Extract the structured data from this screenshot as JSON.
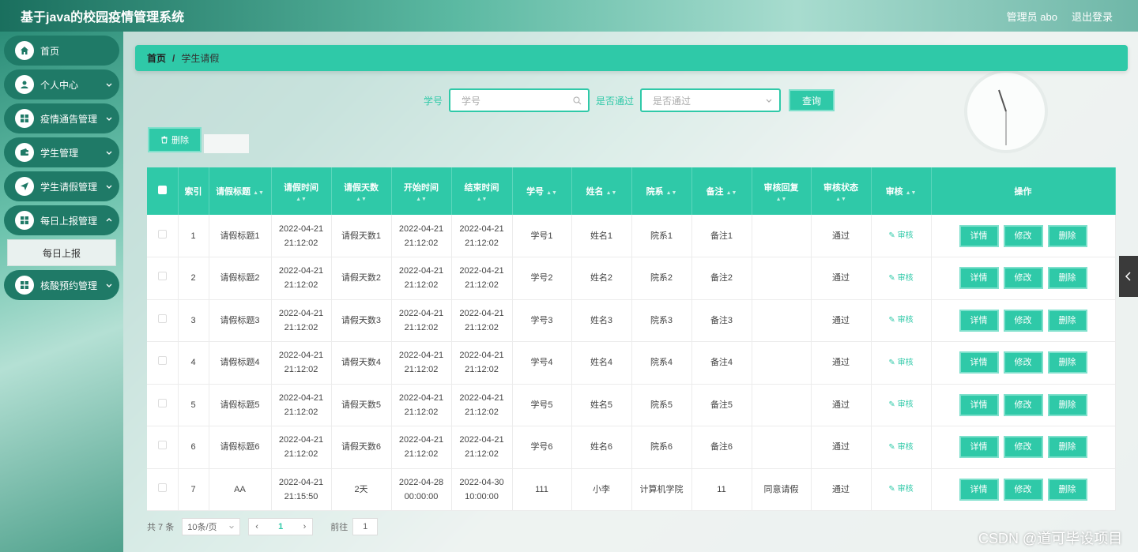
{
  "app": {
    "title": "基于java的校园疫情管理系统",
    "user": "管理员 abo",
    "logout": "退出登录"
  },
  "sidebar": {
    "items": [
      {
        "label": "首页",
        "icon": "home-icon"
      },
      {
        "label": "个人中心",
        "icon": "user-icon"
      },
      {
        "label": "疫情通告管理",
        "icon": "grid-icon"
      },
      {
        "label": "学生管理",
        "icon": "wallet-icon"
      },
      {
        "label": "学生请假管理",
        "icon": "send-icon"
      },
      {
        "label": "每日上报管理",
        "icon": "grid-icon"
      },
      {
        "label": "核酸预约管理",
        "icon": "grid-icon"
      }
    ],
    "submenu": {
      "label": "每日上报"
    }
  },
  "breadcrumb": {
    "home": "首页",
    "separator": "/",
    "current": "学生请假"
  },
  "search": {
    "student_no_label": "学号",
    "student_no_placeholder": "学号",
    "approved_label": "是否通过",
    "approved_placeholder": "是否通过",
    "query_button": "查询"
  },
  "toolbar": {
    "delete_button": "删除"
  },
  "table": {
    "headers": [
      "索引",
      "请假标题",
      "请假时间",
      "请假天数",
      "开始时间",
      "结束时间",
      "学号",
      "姓名",
      "院系",
      "备注",
      "审核回复",
      "审核状态",
      "审核",
      "操作"
    ],
    "audit_link": "审核",
    "buttons": {
      "detail": "详情",
      "edit": "修改",
      "delete": "删除"
    },
    "rows": [
      {
        "index": "1",
        "title": "请假标题1",
        "leave_time": "2022-04-21 21:12:02",
        "days": "请假天数1",
        "start": "2022-04-21 21:12:02",
        "end": "2022-04-21 21:12:02",
        "student_no": "学号1",
        "name": "姓名1",
        "dept": "院系1",
        "remark": "备注1",
        "reply": "",
        "status": "通过"
      },
      {
        "index": "2",
        "title": "请假标题2",
        "leave_time": "2022-04-21 21:12:02",
        "days": "请假天数2",
        "start": "2022-04-21 21:12:02",
        "end": "2022-04-21 21:12:02",
        "student_no": "学号2",
        "name": "姓名2",
        "dept": "院系2",
        "remark": "备注2",
        "reply": "",
        "status": "通过"
      },
      {
        "index": "3",
        "title": "请假标题3",
        "leave_time": "2022-04-21 21:12:02",
        "days": "请假天数3",
        "start": "2022-04-21 21:12:02",
        "end": "2022-04-21 21:12:02",
        "student_no": "学号3",
        "name": "姓名3",
        "dept": "院系3",
        "remark": "备注3",
        "reply": "",
        "status": "通过"
      },
      {
        "index": "4",
        "title": "请假标题4",
        "leave_time": "2022-04-21 21:12:02",
        "days": "请假天数4",
        "start": "2022-04-21 21:12:02",
        "end": "2022-04-21 21:12:02",
        "student_no": "学号4",
        "name": "姓名4",
        "dept": "院系4",
        "remark": "备注4",
        "reply": "",
        "status": "通过"
      },
      {
        "index": "5",
        "title": "请假标题5",
        "leave_time": "2022-04-21 21:12:02",
        "days": "请假天数5",
        "start": "2022-04-21 21:12:02",
        "end": "2022-04-21 21:12:02",
        "student_no": "学号5",
        "name": "姓名5",
        "dept": "院系5",
        "remark": "备注5",
        "reply": "",
        "status": "通过"
      },
      {
        "index": "6",
        "title": "请假标题6",
        "leave_time": "2022-04-21 21:12:02",
        "days": "请假天数6",
        "start": "2022-04-21 21:12:02",
        "end": "2022-04-21 21:12:02",
        "student_no": "学号6",
        "name": "姓名6",
        "dept": "院系6",
        "remark": "备注6",
        "reply": "",
        "status": "通过"
      },
      {
        "index": "7",
        "title": "AA",
        "leave_time": "2022-04-21 21:15:50",
        "days": "2天",
        "start": "2022-04-28 00:00:00",
        "end": "2022-04-30 10:00:00",
        "student_no": "111",
        "name": "小李",
        "dept": "计算机学院",
        "remark": "11",
        "reply": "同意请假",
        "status": "通过"
      }
    ]
  },
  "pagination": {
    "total": "共 7 条",
    "page_size": "10条/页",
    "current_page": "1",
    "goto_label": "前往",
    "goto_value": "1"
  },
  "watermark": "CSDN @道可毕设项目"
}
